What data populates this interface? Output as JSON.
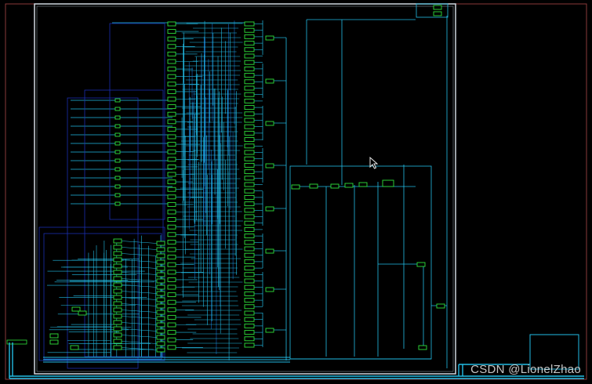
{
  "view": {
    "type": "schematic-viewer",
    "background_color": "#000000",
    "outer_frame_color": "#8a3a3a",
    "module_box_color": "#cfd8e0",
    "wire_colors": {
      "bright": "#22bde6",
      "dark": "#1a2fb0",
      "mid": "#1669c9"
    },
    "cell_color": "#2fe03a"
  },
  "watermark": {
    "text": "CSDN @LionelZhao"
  },
  "cursor": {
    "icon": "mouse-pointer-icon"
  }
}
